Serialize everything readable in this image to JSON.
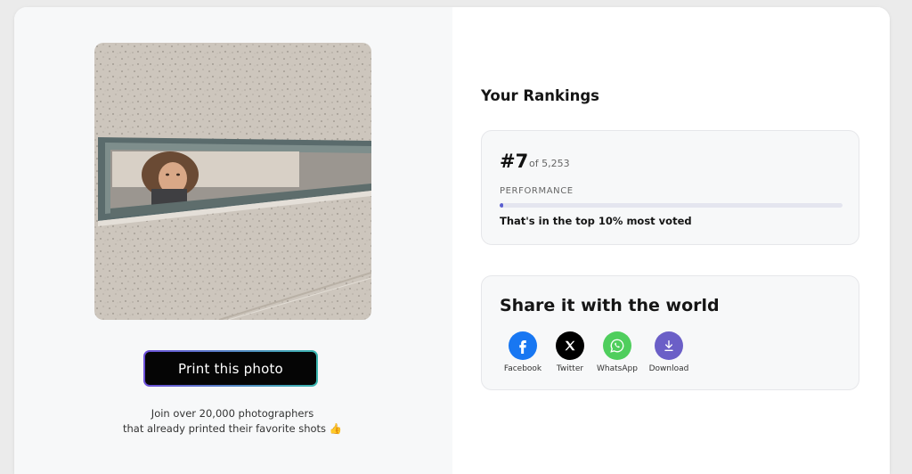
{
  "left": {
    "print_button_label": "Print this photo",
    "join_line1": "Join over 20,000 photographers",
    "join_line2": "that already printed their favorite shots 👍"
  },
  "rankings": {
    "heading": "Your Rankings",
    "rank": "#7",
    "total": "of 5,253",
    "performance_label": "PERFORMANCE",
    "performance_fraction": 0.01,
    "summary": "That's in the top 10% most voted"
  },
  "share": {
    "title": "Share it with the world",
    "items": [
      {
        "label": "Facebook",
        "icon": "facebook-icon",
        "color": "#1877f2"
      },
      {
        "label": "Twitter",
        "icon": "x-icon",
        "color": "#000000"
      },
      {
        "label": "WhatsApp",
        "icon": "whatsapp-icon",
        "color": "#4fce5d"
      },
      {
        "label": "Download",
        "icon": "download-icon",
        "color": "#6b5fc7"
      }
    ]
  },
  "colors": {
    "accent": "#5b5fd0",
    "button_gradient_start": "#6c4fd8",
    "button_gradient_end": "#3bb7b0"
  }
}
